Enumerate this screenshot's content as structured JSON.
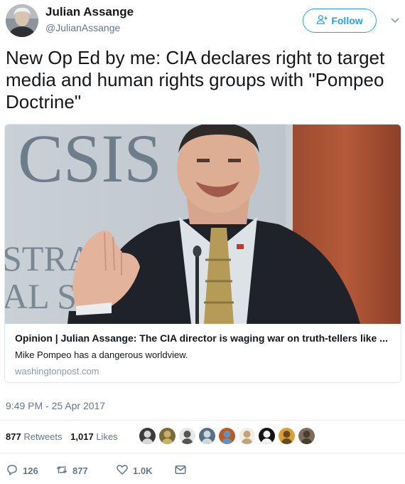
{
  "author": {
    "name": "Julian Assange",
    "handle": "@JulianAssange"
  },
  "follow_label": "Follow",
  "tweet_text": "New Op Ed by me: CIA declares right to target media and human rights groups with \"Pompeo Doctrine\"",
  "card": {
    "image_sign_line1": "CSIS",
    "image_sign_line2": "STRA",
    "image_sign_line3": "AL ST",
    "title": "Opinion | Julian Assange: The CIA director is waging war on truth-tellers like ...",
    "description": "Mike Pompeo has a dangerous worldview.",
    "domain": "washingtonpost.com"
  },
  "timestamp": "9:49 PM - 25 Apr 2017",
  "stats": {
    "retweets_count": "877",
    "retweets_label": "Retweets",
    "likes_count": "1,017",
    "likes_label": "Likes"
  },
  "actions": {
    "reply_count": "126",
    "retweet_count": "877",
    "like_count": "1.0K"
  },
  "colors": {
    "accent": "#1da1f2",
    "muted": "#657786",
    "text": "#14171a",
    "border": "#e1e8ed"
  },
  "icons": [
    "avatar",
    "follow-person-icon",
    "chevron-down-icon",
    "reply-icon",
    "retweet-icon",
    "like-icon",
    "message-icon"
  ],
  "liker_avatars": [
    {
      "bg": "#3c3c3c",
      "fg": "#d8d8d8"
    },
    {
      "bg": "#7a6a3a",
      "fg": "#c9b06a"
    },
    {
      "bg": "#e8e8e8",
      "fg": "#555555"
    },
    {
      "bg": "#5a7080",
      "fg": "#cfd8de"
    },
    {
      "bg": "#b85a2a",
      "fg": "#6b8fb0"
    },
    {
      "bg": "#f2eee6",
      "fg": "#c7a07a"
    },
    {
      "bg": "#141414",
      "fg": "#f5f5f5"
    },
    {
      "bg": "#d9a03a",
      "fg": "#6a4a1a"
    },
    {
      "bg": "#7a6e5e",
      "fg": "#4a3e2e"
    }
  ]
}
